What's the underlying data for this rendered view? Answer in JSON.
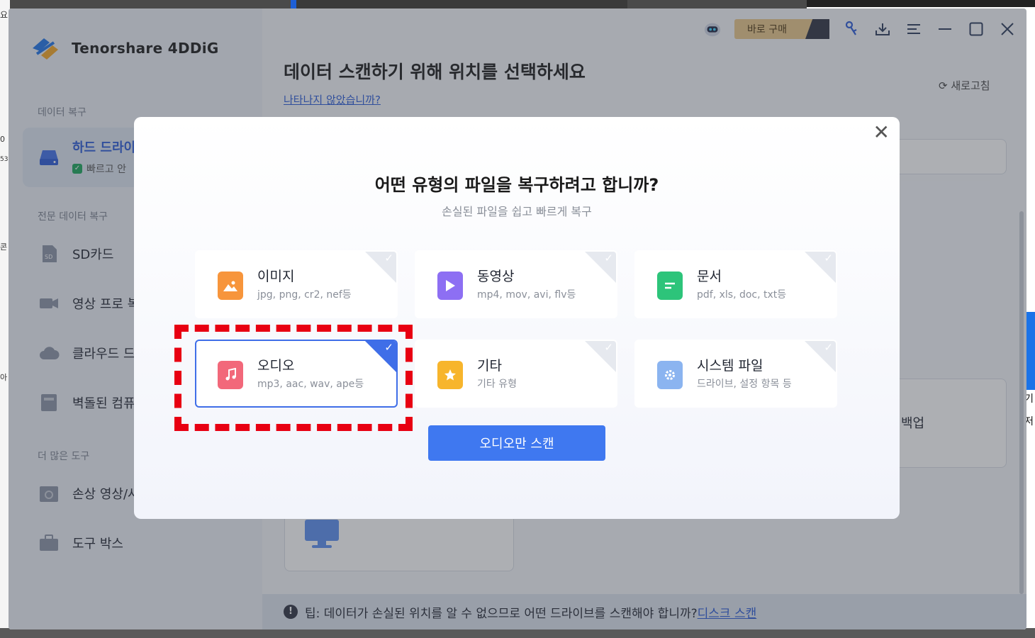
{
  "app": {
    "brand": "Tenorshare 4DDiG",
    "buy_label": "바로 구매"
  },
  "background": {
    "left_frags": [
      "요",
      "0",
      "53",
      "콘",
      "아"
    ],
    "right_frags": [
      "기",
      "저"
    ]
  },
  "sidebar": {
    "section_recovery": "데이터 복구",
    "active_item": {
      "label": "하드 드라이",
      "sub": "빠르고 안"
    },
    "section_pro": "전문 데이터 복구",
    "items": [
      {
        "label": "SD카드",
        "icon": "sd-card-icon"
      },
      {
        "label": "영상 프로 복",
        "icon": "camera-icon"
      },
      {
        "label": "클라우드 드",
        "icon": "cloud-icon"
      },
      {
        "label": "벽돌된 컴퓨",
        "icon": "crashed-pc-icon"
      }
    ],
    "section_tools": "더 많은 도구",
    "tools": [
      {
        "label": "손상 영상/사",
        "icon": "repair-icon"
      },
      {
        "label": "도구 박스",
        "icon": "toolbox-icon"
      }
    ]
  },
  "main": {
    "title": "데이터 스캔하기 위해 위치를 선택하세요",
    "not_shown_link": "나타나지 않았습니까?",
    "refresh": "새로고침",
    "backup_label": "백업",
    "tip_text": "팁: 데이터가 손실된 위치를 알 수 없으므로 어떤 드라이브를 스캔해야 합니까?",
    "tip_link": "디스크 스캔"
  },
  "modal": {
    "title": "어떤 유형의 파일을 복구하려고 합니까?",
    "subtitle": "손실된 파일을 쉽고 빠르게 복구",
    "cards": [
      {
        "name": "이미지",
        "ext": "jpg, png, cr2, nef등",
        "color": "#f7953c",
        "icon": "image-file-icon",
        "selected": false
      },
      {
        "name": "동영상",
        "ext": "mp4, mov, avi, flv등",
        "color": "#8d6ff3",
        "icon": "video-file-icon",
        "selected": false
      },
      {
        "name": "문서",
        "ext": "pdf, xls, doc, txt등",
        "color": "#2dc47a",
        "icon": "document-file-icon",
        "selected": false
      },
      {
        "name": "오디오",
        "ext": "mp3, aac, wav, ape등",
        "color": "#f2687a",
        "icon": "audio-file-icon",
        "selected": true
      },
      {
        "name": "기타",
        "ext": "기타 유형",
        "color": "#f7b52c",
        "icon": "other-file-icon",
        "selected": false
      },
      {
        "name": "시스템 파일",
        "ext": "드라이브, 설정 항목 등",
        "color": "#8bb4f0",
        "icon": "system-file-icon",
        "selected": false
      }
    ],
    "scan_button": "오디오만 스캔",
    "highlight_color": "#e80012"
  }
}
